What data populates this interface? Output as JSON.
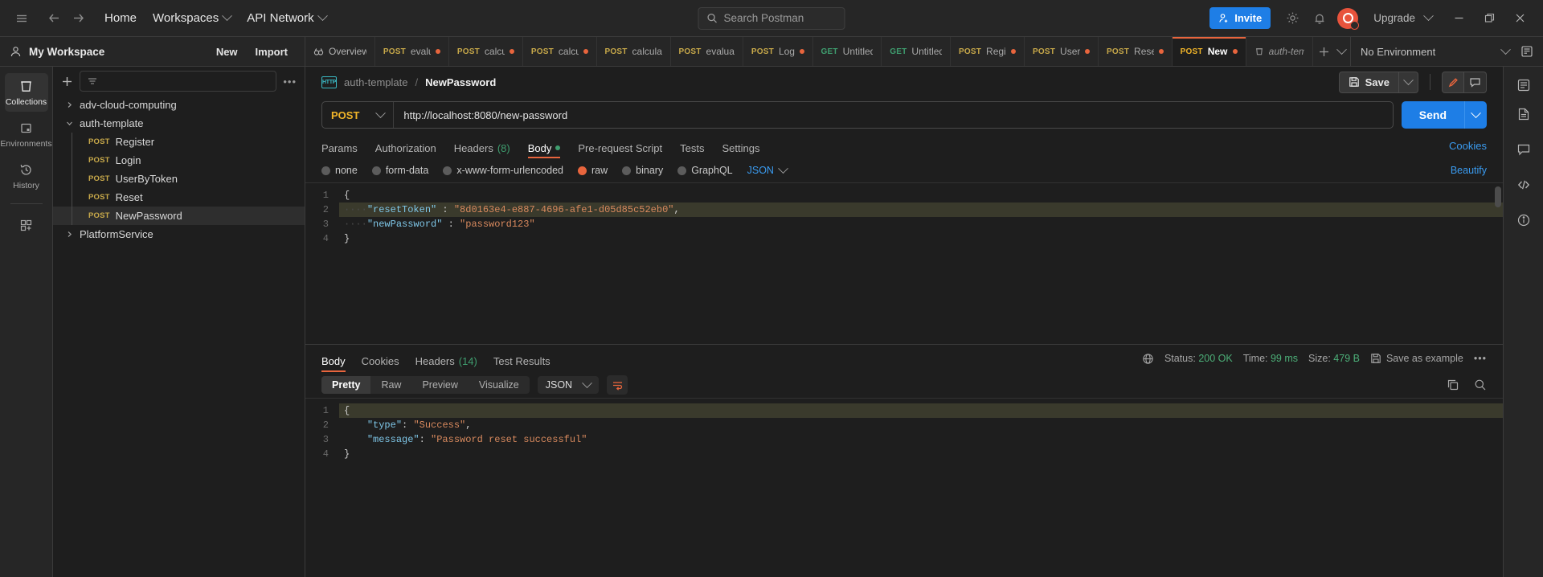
{
  "topbar": {
    "menu_icon": "hamburger-icon",
    "back_icon": "back-arrow-icon",
    "forward_icon": "forward-arrow-icon",
    "home": "Home",
    "workspaces": "Workspaces",
    "api_network": "API Network",
    "search_placeholder": "Search Postman",
    "invite": "Invite",
    "settings_icon": "gear-icon",
    "notifications_icon": "bell-icon",
    "upgrade": "Upgrade",
    "minimize": "—",
    "maximize": "❐",
    "close": "✕"
  },
  "workspace": {
    "name": "My Workspace",
    "new_label": "New",
    "import_label": "Import"
  },
  "rail": {
    "items": [
      {
        "label": "Collections",
        "icon": "collections-icon",
        "active": true
      },
      {
        "label": "Environments",
        "icon": "environments-icon",
        "active": false
      },
      {
        "label": "History",
        "icon": "history-icon",
        "active": false
      }
    ],
    "add_label": "add-apps-icon"
  },
  "sidebar": {
    "add_icon": "plus-icon",
    "filter_icon": "filter-icon",
    "more_icon": "more-options-icon",
    "tree": [
      {
        "label": "adv-cloud-computing",
        "type": "collection",
        "expanded": false,
        "depth": 0
      },
      {
        "label": "auth-template",
        "type": "collection",
        "expanded": true,
        "depth": 0
      },
      {
        "label": "Register",
        "type": "request",
        "method": "POST",
        "depth": 1
      },
      {
        "label": "Login",
        "type": "request",
        "method": "POST",
        "depth": 1
      },
      {
        "label": "UserByToken",
        "type": "request",
        "method": "POST",
        "depth": 1
      },
      {
        "label": "Reset",
        "type": "request",
        "method": "POST",
        "depth": 1
      },
      {
        "label": "NewPassword",
        "type": "request",
        "method": "POST",
        "depth": 1,
        "selected": true
      },
      {
        "label": "PlatformService",
        "type": "collection",
        "expanded": false,
        "depth": 0
      }
    ]
  },
  "tabstrip": {
    "tabs": [
      {
        "label": "Overview",
        "method": "",
        "dirty": false,
        "active": false,
        "kind": "overview"
      },
      {
        "label": "evalua",
        "method": "POST",
        "dirty": true,
        "active": false
      },
      {
        "label": "calcul",
        "method": "POST",
        "dirty": true,
        "active": false
      },
      {
        "label": "calcu",
        "method": "POST",
        "dirty": true,
        "active": false
      },
      {
        "label": "calculat",
        "method": "POST",
        "dirty": false,
        "active": false
      },
      {
        "label": "evaluat",
        "method": "POST",
        "dirty": false,
        "active": false
      },
      {
        "label": "Logi",
        "method": "POST",
        "dirty": true,
        "active": false
      },
      {
        "label": "Untitled",
        "method": "GET",
        "dirty": false,
        "active": false
      },
      {
        "label": "Untitled",
        "method": "GET",
        "dirty": false,
        "active": false
      },
      {
        "label": "Regis",
        "method": "POST",
        "dirty": true,
        "active": false
      },
      {
        "label": "UserB",
        "method": "POST",
        "dirty": true,
        "active": false
      },
      {
        "label": "Rese",
        "method": "POST",
        "dirty": true,
        "active": false
      },
      {
        "label": "NewP",
        "method": "POST",
        "dirty": true,
        "active": true
      },
      {
        "label": "auth-tem",
        "method": "",
        "dirty": false,
        "active": false,
        "kind": "collection"
      }
    ],
    "new_tab_icon": "plus-icon",
    "tab_list_icon": "chevron-down-icon"
  },
  "environment": {
    "selected": "No Environment",
    "caret_icon": "chevron-down-icon",
    "eye_icon": "environment-quick-look-icon"
  },
  "request": {
    "breadcrumb_collection": "auth-template",
    "breadcrumb_separator": "/",
    "breadcrumb_name": "NewPassword",
    "protocol_badge": "HTTP",
    "save_label": "Save",
    "save_icon": "save-icon",
    "edit_icon": "pencil-icon",
    "comment_icon": "comment-icon",
    "method": "POST",
    "url": "http://localhost:8080/new-password",
    "send_label": "Send",
    "tabs": [
      {
        "label": "Params",
        "active": false
      },
      {
        "label": "Authorization",
        "active": false
      },
      {
        "label": "Headers",
        "count": "(8)",
        "active": false
      },
      {
        "label": "Body",
        "active": true,
        "dot": true
      },
      {
        "label": "Pre-request Script",
        "active": false
      },
      {
        "label": "Tests",
        "active": false
      },
      {
        "label": "Settings",
        "active": false
      }
    ],
    "cookies_link": "Cookies",
    "body_modes": [
      {
        "label": "none",
        "selected": false
      },
      {
        "label": "form-data",
        "selected": false
      },
      {
        "label": "x-www-form-urlencoded",
        "selected": false
      },
      {
        "label": "raw",
        "selected": true
      },
      {
        "label": "binary",
        "selected": false
      },
      {
        "label": "GraphQL",
        "selected": false
      }
    ],
    "body_format": "JSON",
    "beautify_label": "Beautify",
    "body_lines": [
      "1",
      "2",
      "3",
      "4"
    ],
    "body_code": {
      "line1": "{",
      "line2_key": "\"resetToken\"",
      "line2_colon": " : ",
      "line2_val": "\"8d0163e4-e887-4696-afe1-d05d85c52eb0\"",
      "line2_comma": ",",
      "line3_key": "\"newPassword\"",
      "line3_colon": " : ",
      "line3_val": "\"password123\"",
      "line4": "}"
    }
  },
  "response": {
    "tabs": [
      {
        "label": "Body",
        "active": true
      },
      {
        "label": "Cookies",
        "active": false
      },
      {
        "label": "Headers",
        "count": "(14)",
        "active": false
      },
      {
        "label": "Test Results",
        "active": false
      }
    ],
    "globe_icon": "globe-icon",
    "status_label": "Status:",
    "status_value": "200 OK",
    "time_label": "Time:",
    "time_value": "99 ms",
    "size_label": "Size:",
    "size_value": "479 B",
    "save_example": "Save as example",
    "save_example_icon": "save-icon",
    "more_icon": "more-options-icon",
    "view_modes": [
      {
        "label": "Pretty",
        "active": true
      },
      {
        "label": "Raw",
        "active": false
      },
      {
        "label": "Preview",
        "active": false
      },
      {
        "label": "Visualize",
        "active": false
      }
    ],
    "format": "JSON",
    "wrap_icon": "word-wrap-icon",
    "copy_icon": "copy-icon",
    "search_icon": "search-icon",
    "body_lines": [
      "1",
      "2",
      "3",
      "4"
    ],
    "body_code": {
      "line1": "{",
      "line2_key": "\"type\"",
      "line2_colon": ": ",
      "line2_val": "\"Success\"",
      "line2_comma": ",",
      "line3_key": "\"message\"",
      "line3_colon": ": ",
      "line3_val": "\"Password reset successful\"",
      "line4": "}"
    }
  },
  "rightrail": {
    "items": [
      {
        "icon": "documentation-icon"
      },
      {
        "icon": "comments-icon"
      },
      {
        "icon": "code-snippet-icon"
      },
      {
        "icon": "info-icon"
      }
    ],
    "top_icon": "layout-icon"
  },
  "colors": {
    "accent_orange": "#e8653d",
    "accent_blue": "#1e7ee6",
    "method_post": "#f0b429",
    "method_get": "#3f9e6f",
    "status_green": "#4caf78",
    "bg": "#1e1e1e",
    "panel": "#262626"
  }
}
